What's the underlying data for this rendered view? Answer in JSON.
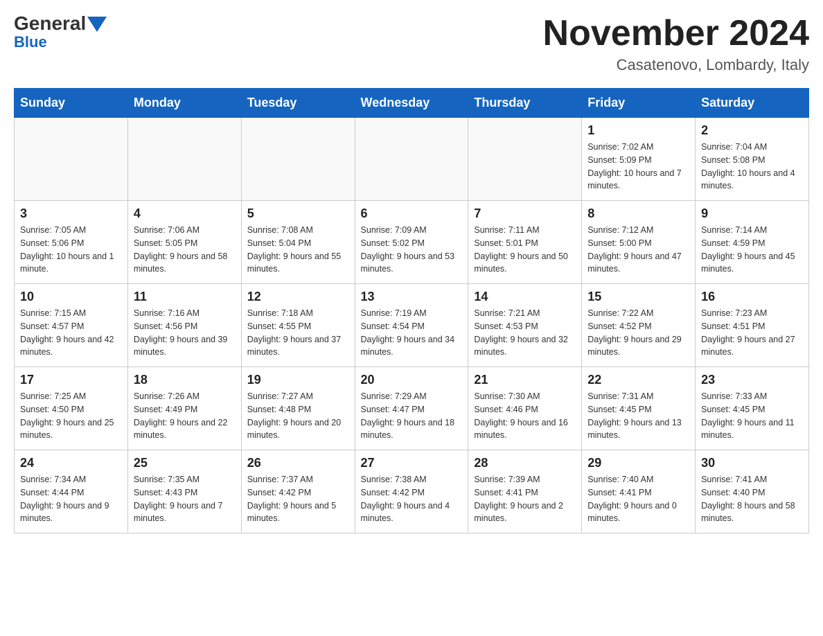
{
  "logo": {
    "general": "General",
    "blue": "Blue"
  },
  "title": "November 2024",
  "location": "Casatenovo, Lombardy, Italy",
  "days_of_week": [
    "Sunday",
    "Monday",
    "Tuesday",
    "Wednesday",
    "Thursday",
    "Friday",
    "Saturday"
  ],
  "weeks": [
    [
      {
        "day": "",
        "info": ""
      },
      {
        "day": "",
        "info": ""
      },
      {
        "day": "",
        "info": ""
      },
      {
        "day": "",
        "info": ""
      },
      {
        "day": "",
        "info": ""
      },
      {
        "day": "1",
        "info": "Sunrise: 7:02 AM\nSunset: 5:09 PM\nDaylight: 10 hours and 7 minutes."
      },
      {
        "day": "2",
        "info": "Sunrise: 7:04 AM\nSunset: 5:08 PM\nDaylight: 10 hours and 4 minutes."
      }
    ],
    [
      {
        "day": "3",
        "info": "Sunrise: 7:05 AM\nSunset: 5:06 PM\nDaylight: 10 hours and 1 minute."
      },
      {
        "day": "4",
        "info": "Sunrise: 7:06 AM\nSunset: 5:05 PM\nDaylight: 9 hours and 58 minutes."
      },
      {
        "day": "5",
        "info": "Sunrise: 7:08 AM\nSunset: 5:04 PM\nDaylight: 9 hours and 55 minutes."
      },
      {
        "day": "6",
        "info": "Sunrise: 7:09 AM\nSunset: 5:02 PM\nDaylight: 9 hours and 53 minutes."
      },
      {
        "day": "7",
        "info": "Sunrise: 7:11 AM\nSunset: 5:01 PM\nDaylight: 9 hours and 50 minutes."
      },
      {
        "day": "8",
        "info": "Sunrise: 7:12 AM\nSunset: 5:00 PM\nDaylight: 9 hours and 47 minutes."
      },
      {
        "day": "9",
        "info": "Sunrise: 7:14 AM\nSunset: 4:59 PM\nDaylight: 9 hours and 45 minutes."
      }
    ],
    [
      {
        "day": "10",
        "info": "Sunrise: 7:15 AM\nSunset: 4:57 PM\nDaylight: 9 hours and 42 minutes."
      },
      {
        "day": "11",
        "info": "Sunrise: 7:16 AM\nSunset: 4:56 PM\nDaylight: 9 hours and 39 minutes."
      },
      {
        "day": "12",
        "info": "Sunrise: 7:18 AM\nSunset: 4:55 PM\nDaylight: 9 hours and 37 minutes."
      },
      {
        "day": "13",
        "info": "Sunrise: 7:19 AM\nSunset: 4:54 PM\nDaylight: 9 hours and 34 minutes."
      },
      {
        "day": "14",
        "info": "Sunrise: 7:21 AM\nSunset: 4:53 PM\nDaylight: 9 hours and 32 minutes."
      },
      {
        "day": "15",
        "info": "Sunrise: 7:22 AM\nSunset: 4:52 PM\nDaylight: 9 hours and 29 minutes."
      },
      {
        "day": "16",
        "info": "Sunrise: 7:23 AM\nSunset: 4:51 PM\nDaylight: 9 hours and 27 minutes."
      }
    ],
    [
      {
        "day": "17",
        "info": "Sunrise: 7:25 AM\nSunset: 4:50 PM\nDaylight: 9 hours and 25 minutes."
      },
      {
        "day": "18",
        "info": "Sunrise: 7:26 AM\nSunset: 4:49 PM\nDaylight: 9 hours and 22 minutes."
      },
      {
        "day": "19",
        "info": "Sunrise: 7:27 AM\nSunset: 4:48 PM\nDaylight: 9 hours and 20 minutes."
      },
      {
        "day": "20",
        "info": "Sunrise: 7:29 AM\nSunset: 4:47 PM\nDaylight: 9 hours and 18 minutes."
      },
      {
        "day": "21",
        "info": "Sunrise: 7:30 AM\nSunset: 4:46 PM\nDaylight: 9 hours and 16 minutes."
      },
      {
        "day": "22",
        "info": "Sunrise: 7:31 AM\nSunset: 4:45 PM\nDaylight: 9 hours and 13 minutes."
      },
      {
        "day": "23",
        "info": "Sunrise: 7:33 AM\nSunset: 4:45 PM\nDaylight: 9 hours and 11 minutes."
      }
    ],
    [
      {
        "day": "24",
        "info": "Sunrise: 7:34 AM\nSunset: 4:44 PM\nDaylight: 9 hours and 9 minutes."
      },
      {
        "day": "25",
        "info": "Sunrise: 7:35 AM\nSunset: 4:43 PM\nDaylight: 9 hours and 7 minutes."
      },
      {
        "day": "26",
        "info": "Sunrise: 7:37 AM\nSunset: 4:42 PM\nDaylight: 9 hours and 5 minutes."
      },
      {
        "day": "27",
        "info": "Sunrise: 7:38 AM\nSunset: 4:42 PM\nDaylight: 9 hours and 4 minutes."
      },
      {
        "day": "28",
        "info": "Sunrise: 7:39 AM\nSunset: 4:41 PM\nDaylight: 9 hours and 2 minutes."
      },
      {
        "day": "29",
        "info": "Sunrise: 7:40 AM\nSunset: 4:41 PM\nDaylight: 9 hours and 0 minutes."
      },
      {
        "day": "30",
        "info": "Sunrise: 7:41 AM\nSunset: 4:40 PM\nDaylight: 8 hours and 58 minutes."
      }
    ]
  ]
}
